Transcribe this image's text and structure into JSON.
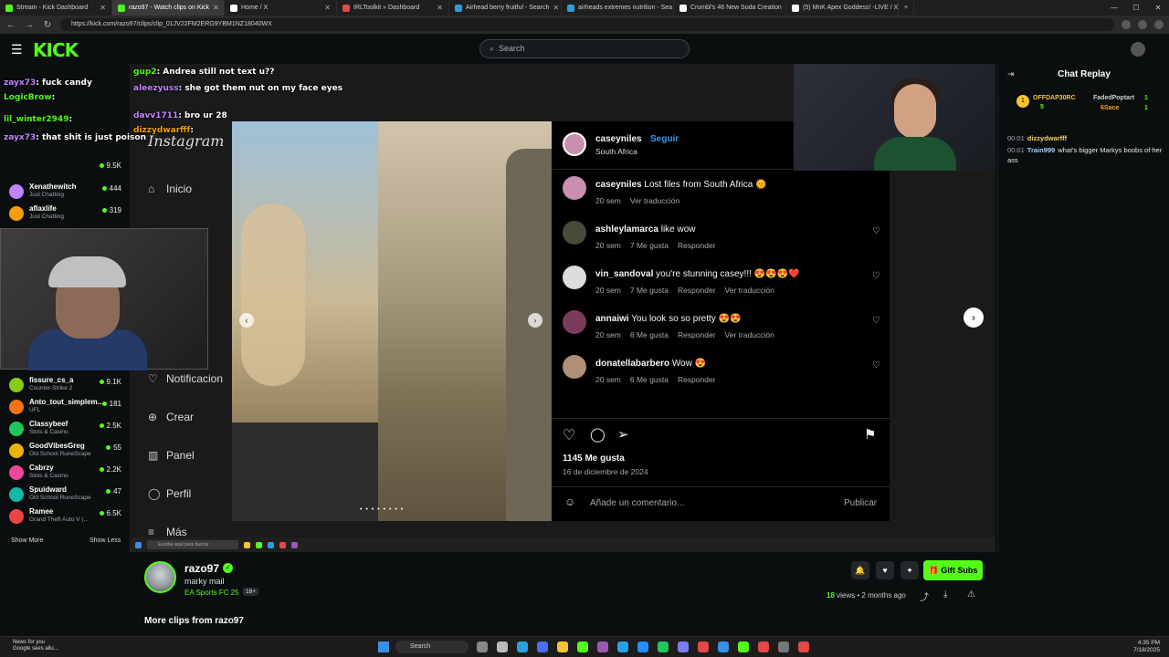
{
  "browser": {
    "tabs": [
      {
        "title": "Stream - Kick Dashboard",
        "color": "#53fc18",
        "active": false
      },
      {
        "title": "razo97 - Watch clips on Kick",
        "color": "#53fc18",
        "active": true
      },
      {
        "title": "Home / X",
        "color": "#ffffff",
        "active": false
      },
      {
        "title": "IRLToolkit » Dashboard",
        "color": "#e54848",
        "active": false
      },
      {
        "title": "Airhead berry fruitful - Search",
        "color": "#2aa0e0",
        "active": false
      },
      {
        "title": "airheads extremes nutrition - Sea",
        "color": "#2aa0e0",
        "active": false
      },
      {
        "title": "Crumbl's 46 New Soda Creation",
        "color": "#ffffff",
        "active": false
      },
      {
        "title": "(5) MnK Apex Goddess! -LIVE / X",
        "color": "#ffffff",
        "active": false
      }
    ],
    "url": "https://kick.com/razo97/clips/clip_01JV22FM2ERG9YBM1NZ18040WX"
  },
  "header": {
    "logo": "KICK",
    "search_placeholder": "Search"
  },
  "sidebar": {
    "channels": [
      {
        "name": "Xenathewitch",
        "category": "Just Chatting",
        "viewers": "444",
        "color": "#c084fc"
      },
      {
        "name": "aflaxlife",
        "category": "Just Chatting",
        "viewers": "319",
        "color": "#f59e0b"
      },
      {
        "name": "fissure_cs_a",
        "category": "Counter-Strike 2",
        "viewers": "9.1K",
        "color": "#84cc16"
      },
      {
        "name": "Anto_tout_simplem...",
        "category": "UFL",
        "viewers": "181",
        "color": "#f97316"
      },
      {
        "name": "Classybeef",
        "category": "Slots & Casino",
        "viewers": "2.5K",
        "color": "#22c55e"
      },
      {
        "name": "GoodVibesGreg",
        "category": "Old School RuneScape",
        "viewers": "55",
        "color": "#eab308"
      },
      {
        "name": "Cabrzy",
        "category": "Slots & Casino",
        "viewers": "2.2K",
        "color": "#ec4899"
      },
      {
        "name": "Spuidward",
        "category": "Old School RuneScape",
        "viewers": "47",
        "color": "#14b8a6"
      },
      {
        "name": "Ramee",
        "category": "Grand Theft Auto V (...",
        "viewers": "6.5K",
        "color": "#ef4444"
      }
    ],
    "first_viewers": "9.5K",
    "show_more": "Show More",
    "show_less": "Show Less"
  },
  "video": {
    "overlay_chat": [
      {
        "user": "gup2",
        "text": "Andrea still not text u??"
      },
      {
        "user": "aleezyuss",
        "text": "she got them nut on my face eyes"
      },
      {
        "user": "davv1711",
        "text": "bro ur 28"
      },
      {
        "user": "dizzydwarfff",
        "text": ""
      },
      {
        "user": "zayx73",
        "text": "fuck candy"
      },
      {
        "user": "LogicBrow",
        "text": ""
      },
      {
        "user": "lil_winter2949",
        "text": ""
      },
      {
        "user": "zayx73",
        "text": "that shit is just poison"
      }
    ],
    "ig_nav": [
      "Inicio",
      "Notificacion",
      "Crear",
      "Panel",
      "Perfil",
      "Más"
    ],
    "ig_logo": "Instagram",
    "taskbar_search": "Escribe aquí para buscar",
    "ig": {
      "owner": "caseyniles",
      "follow": "Seguir",
      "location": "South Africa",
      "comments": [
        {
          "user": "caseyniles",
          "text": "Lost files from South Africa 🌞",
          "meta": [
            "20 sem",
            "Ver traducción"
          ],
          "avatar": "#c98fb0"
        },
        {
          "user": "ashleylamarca",
          "text": "like wow",
          "meta": [
            "20 sem",
            "7 Me gusta",
            "Responder"
          ],
          "avatar": "#4a4a3a"
        },
        {
          "user": "vin_sandoval",
          "text": "you're stunning casey!!! 😍😍😍❤️",
          "meta": [
            "20 sem",
            "7 Me gusta",
            "Responder",
            "Ver traducción"
          ],
          "avatar": "#ddd"
        },
        {
          "user": "annaiwi",
          "text": "You look so so pretty 😍😍",
          "meta": [
            "20 sem",
            "6 Me gusta",
            "Responder",
            "Ver traducción"
          ],
          "avatar": "#7a3b5a"
        },
        {
          "user": "donatellabarbero",
          "text": "Wow 😍",
          "meta": [
            "20 sem",
            "6 Me gusta",
            "Responder"
          ],
          "avatar": "#b08f78"
        }
      ],
      "likes": "1145 Me gusta",
      "date": "16 de diciembre de 2024",
      "comment_placeholder": "Añade un comentario...",
      "publish": "Publicar"
    }
  },
  "chat": {
    "title": "Chat Replay",
    "gifters": [
      {
        "name": "OFFDAP30RC",
        "count": "5"
      },
      {
        "name": "FadedPoptart",
        "count": "1"
      },
      {
        "name": "6Sace",
        "count": "1"
      }
    ],
    "messages": [
      {
        "time": "00:01",
        "user": "dizzydwarfff",
        "text": "",
        "color": "#f0d060"
      },
      {
        "time": "00:01",
        "user": "Train999",
        "text": "what's bigger Markys boobs of her ass",
        "color": "#9fd0ff"
      }
    ]
  },
  "clip": {
    "streamer": "razo97",
    "title": "marky mail",
    "category": "EA Sports FC 25",
    "age": "18+",
    "gift_label": "Gift Subs",
    "views_count": "18",
    "views_label": "views",
    "age_posted": "2 months ago",
    "more_clips": "More clips from razo97"
  },
  "taskbar": {
    "news_line1": "News for you",
    "news_line2": "Google sees allu...",
    "search": "Search",
    "time": "4:35 PM",
    "date": "7/18/2025"
  }
}
